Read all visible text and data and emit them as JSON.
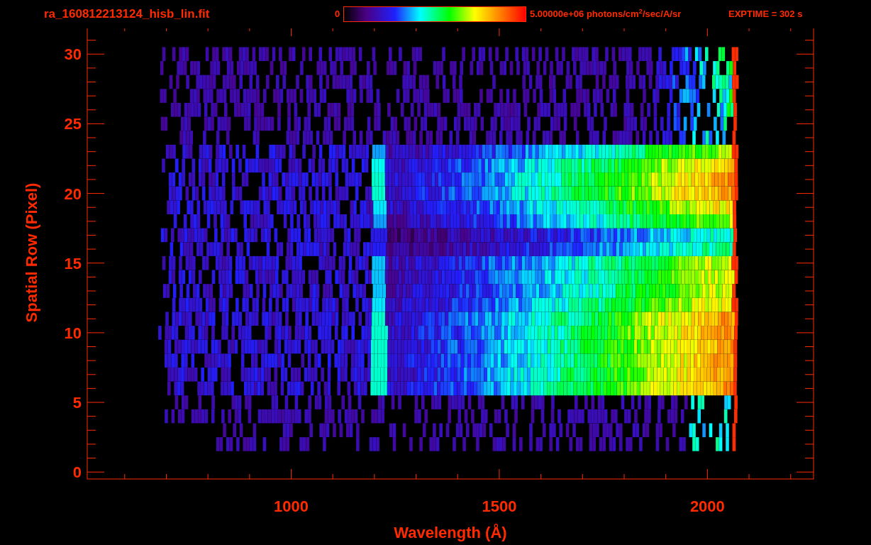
{
  "title": "ra_160812213124_hisb_lin.fit",
  "colorbar": {
    "min_label": "0",
    "max_label": "5.00000e+06 photons/cm$^{2}$/sec/A/sr"
  },
  "exposure": "EXPTIME = 302 s",
  "x_axis": {
    "label": "Wavelength (Å)",
    "ticks": [
      "1000",
      "1500",
      "2000"
    ]
  },
  "y_axis": {
    "label": "Spatial Row (Pixel)",
    "ticks": [
      "30",
      "25",
      "20",
      "15",
      "10",
      "5",
      "0"
    ]
  }
}
